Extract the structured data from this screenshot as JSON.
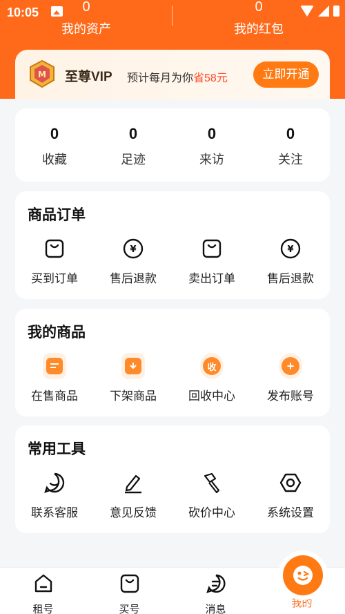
{
  "status_bar": {
    "time": "10:05"
  },
  "assets": [
    {
      "value": "0",
      "label": "我的资产"
    },
    {
      "value": "0",
      "label": "我的红包"
    }
  ],
  "vip": {
    "title": "至尊VIP",
    "desc_prefix": "预计每月为你",
    "desc_highlight": "省58元",
    "button": "立即开通"
  },
  "stats": [
    {
      "value": "0",
      "label": "收藏"
    },
    {
      "value": "0",
      "label": "足迹"
    },
    {
      "value": "0",
      "label": "来访"
    },
    {
      "value": "0",
      "label": "关注"
    }
  ],
  "orders": {
    "title": "商品订单",
    "items": [
      {
        "label": "买到订单",
        "icon": "bag-icon"
      },
      {
        "label": "售后退款",
        "icon": "yuan-icon"
      },
      {
        "label": "卖出订单",
        "icon": "bag-icon"
      },
      {
        "label": "售后退款",
        "icon": "yuan-icon"
      }
    ]
  },
  "goods": {
    "title": "我的商品",
    "items": [
      {
        "label": "在售商品",
        "icon": "on-sale-icon"
      },
      {
        "label": "下架商品",
        "icon": "off-shelf-icon"
      },
      {
        "label": "回收中心",
        "icon": "recycle-icon",
        "glyph": "收"
      },
      {
        "label": "发布账号",
        "icon": "add-icon",
        "glyph": "+"
      }
    ]
  },
  "tools": {
    "title": "常用工具",
    "items": [
      {
        "label": "联系客服",
        "icon": "chat-smile-icon"
      },
      {
        "label": "意见反馈",
        "icon": "pen-icon"
      },
      {
        "label": "砍价中心",
        "icon": "axe-icon"
      },
      {
        "label": "系统设置",
        "icon": "hex-gear-icon"
      }
    ]
  },
  "tabbar": [
    {
      "label": "租号",
      "icon": "home-icon"
    },
    {
      "label": "买号",
      "icon": "bag-icon"
    },
    {
      "label": "消息",
      "icon": "message-icon"
    },
    {
      "label": "我的",
      "icon": "wink-face-icon",
      "active": true
    }
  ],
  "colors": {
    "accent": "#ff6a1a",
    "button": "#ff7a12",
    "highlight": "#ff4a2a"
  }
}
